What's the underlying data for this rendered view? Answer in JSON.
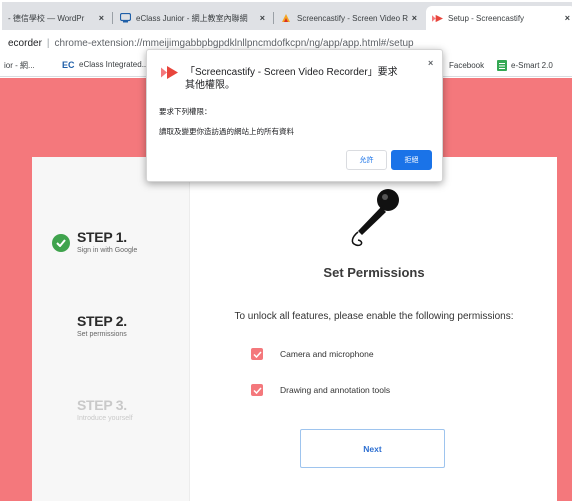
{
  "tabs": [
    {
      "title": "- 德信學校 — WordPr",
      "close": "×",
      "icon": "wordpress-icon"
    },
    {
      "title": "eClass Junior - 網上教室內聯網",
      "close": "×",
      "icon": "eclass-icon"
    },
    {
      "title": "Screencastify - Screen Video Re",
      "close": "×",
      "icon": "screencastify-icon"
    },
    {
      "title": "Setup - Screencastify",
      "close": "×",
      "icon": "screencastify-icon"
    }
  ],
  "address": {
    "site_name": "ecorder",
    "separator": "|",
    "url": "chrome-extension://mmeijimgabbpbgpdklnllpncmdofkcpn/ng/app/app.html#/setup"
  },
  "bookmarks": [
    {
      "label": "ior - 網..."
    },
    {
      "label": "eClass Integrated..."
    },
    {
      "label": "Facebook"
    },
    {
      "label": "e-Smart 2.0"
    }
  ],
  "dialog": {
    "title": "「Screencastify - Screen Video Recorder」要求其他權限。",
    "close": "×",
    "requests_label": "要求下列權限：",
    "permission_item": "讀取及變更你造訪過的網站上的所有資料",
    "allow_label": "允許",
    "deny_label": "拒絕"
  },
  "steps": [
    {
      "title": "STEP 1.",
      "subtitle": "Sign in with Google",
      "state": "done"
    },
    {
      "title": "STEP 2.",
      "subtitle": "Set permissions",
      "state": "current"
    },
    {
      "title": "STEP 3.",
      "subtitle": "Introduce yourself",
      "state": "upcoming"
    }
  ],
  "main": {
    "title": "Set Permissions",
    "description": "To unlock all features, please enable the following permissions:",
    "permissions": [
      {
        "label": "Camera and microphone",
        "checked": true
      },
      {
        "label": "Drawing and annotation tools",
        "checked": true
      }
    ],
    "next_label": "Next"
  },
  "colors": {
    "page_background": "#f4787c",
    "checkbox": "#f4787c",
    "step_done": "#3fa34d",
    "primary_blue": "#1a73e8",
    "next_text": "#2d6fd1"
  }
}
